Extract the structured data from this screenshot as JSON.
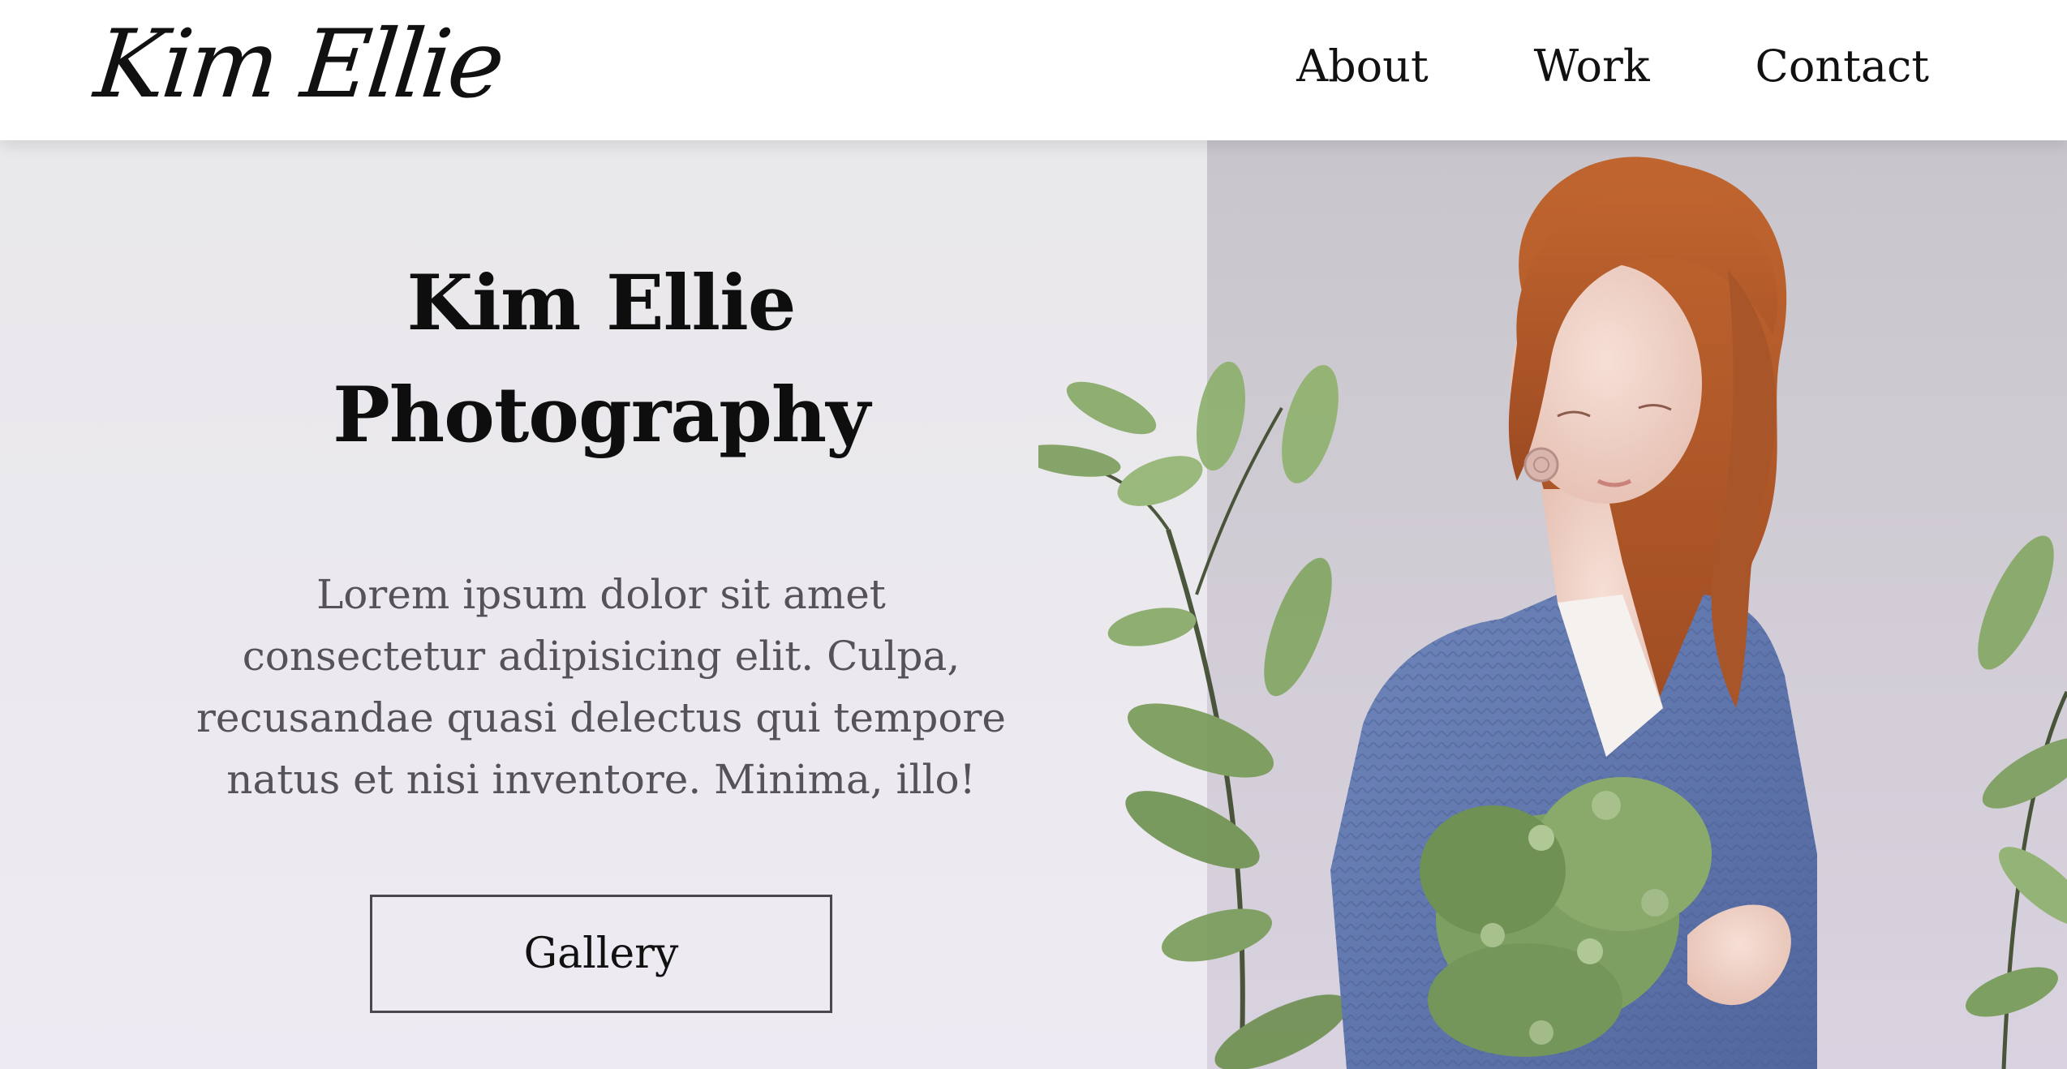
{
  "header": {
    "logo": "Kim Ellie",
    "nav": [
      {
        "label": "About"
      },
      {
        "label": "Work"
      },
      {
        "label": "Contact"
      }
    ]
  },
  "hero": {
    "title_line1": "Kim Ellie",
    "title_line2": "Photography",
    "description": "Lorem ipsum dolor sit amet consectetur adipisicing elit. Culpa, recusandae quasi delectus qui tempore natus et nisi inventore. Minima, illo!",
    "button_label": "Gallery"
  },
  "colors": {
    "left_panel_bg": "#e9e8ea",
    "right_panel_bg": "#c8c6cc",
    "sweater": "#5f77ad",
    "hair": "#b35a2c",
    "leaves": "#7d9f5e",
    "text_primary": "#0e0e0e",
    "text_muted": "#55525a"
  },
  "image": {
    "subject_icon": "woman-with-flowers-photo"
  }
}
